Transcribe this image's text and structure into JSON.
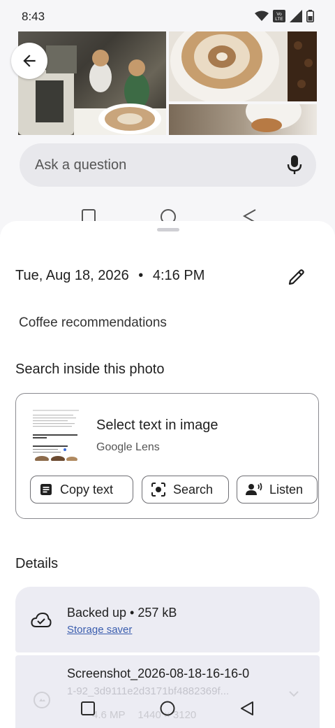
{
  "status": {
    "time": "8:43",
    "volte": "Vo LTE"
  },
  "search": {
    "placeholder": "Ask a question"
  },
  "info": {
    "date": "Tue, Aug 18, 2026",
    "separator": "•",
    "time": "4:16 PM",
    "caption": "Coffee recommendations"
  },
  "lens": {
    "section_title": "Search inside this photo",
    "title": "Select text in image",
    "subtitle": "Google Lens",
    "thumbnail_lines": [
      "Quiet Cafes in the Yangon & Ambi Area",
      "Chai Coffee Chocolat Ca..."
    ],
    "chips": {
      "copy": "Copy text",
      "search": "Search",
      "listen": "Listen"
    }
  },
  "details": {
    "section_title": "Details",
    "backup_status": "Backed up • 257 kB",
    "storage_link": "Storage saver",
    "filename": "Screenshot_2026-08-18-16-16-0",
    "hash": "1-92_3d9111e2d3171bf4882369f...",
    "meta_mp": "4.6 MP",
    "meta_res": "1440 × 3120"
  },
  "colors": {
    "sheet": "#ffffff",
    "background": "#f6f6f8",
    "detail_card": "#ececf3",
    "link": "#3a5dae"
  },
  "icons": [
    "wifi-icon",
    "volte-icon",
    "signal-icon",
    "battery-icon",
    "back-arrow-icon",
    "mic-icon",
    "pencil-icon",
    "copy-text-icon",
    "lens-search-icon",
    "listen-icon",
    "cloud-check-icon",
    "chevron-down-icon",
    "recents-icon",
    "home-icon",
    "back-nav-icon"
  ]
}
